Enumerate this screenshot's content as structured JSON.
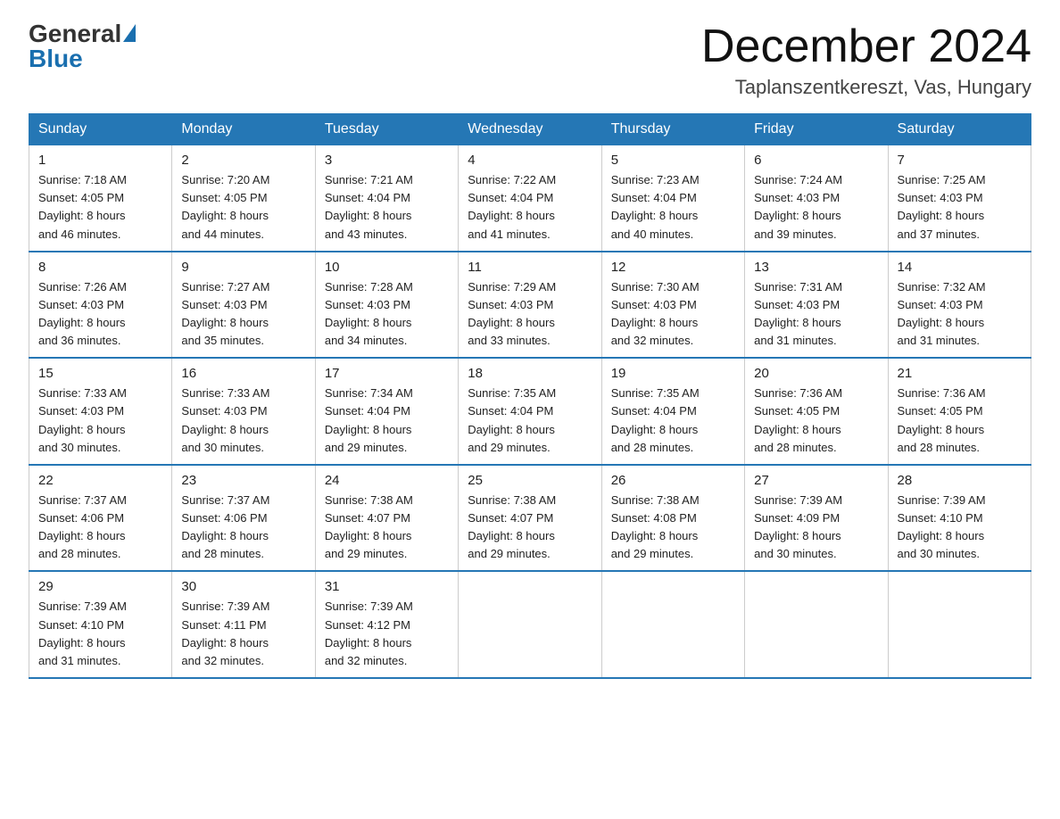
{
  "header": {
    "logo_general": "General",
    "logo_blue": "Blue",
    "month_title": "December 2024",
    "location": "Taplanszentkereszt, Vas, Hungary"
  },
  "days_of_week": [
    "Sunday",
    "Monday",
    "Tuesday",
    "Wednesday",
    "Thursday",
    "Friday",
    "Saturday"
  ],
  "weeks": [
    [
      {
        "day": "1",
        "sunrise": "7:18 AM",
        "sunset": "4:05 PM",
        "daylight": "8 hours and 46 minutes."
      },
      {
        "day": "2",
        "sunrise": "7:20 AM",
        "sunset": "4:05 PM",
        "daylight": "8 hours and 44 minutes."
      },
      {
        "day": "3",
        "sunrise": "7:21 AM",
        "sunset": "4:04 PM",
        "daylight": "8 hours and 43 minutes."
      },
      {
        "day": "4",
        "sunrise": "7:22 AM",
        "sunset": "4:04 PM",
        "daylight": "8 hours and 41 minutes."
      },
      {
        "day": "5",
        "sunrise": "7:23 AM",
        "sunset": "4:04 PM",
        "daylight": "8 hours and 40 minutes."
      },
      {
        "day": "6",
        "sunrise": "7:24 AM",
        "sunset": "4:03 PM",
        "daylight": "8 hours and 39 minutes."
      },
      {
        "day": "7",
        "sunrise": "7:25 AM",
        "sunset": "4:03 PM",
        "daylight": "8 hours and 37 minutes."
      }
    ],
    [
      {
        "day": "8",
        "sunrise": "7:26 AM",
        "sunset": "4:03 PM",
        "daylight": "8 hours and 36 minutes."
      },
      {
        "day": "9",
        "sunrise": "7:27 AM",
        "sunset": "4:03 PM",
        "daylight": "8 hours and 35 minutes."
      },
      {
        "day": "10",
        "sunrise": "7:28 AM",
        "sunset": "4:03 PM",
        "daylight": "8 hours and 34 minutes."
      },
      {
        "day": "11",
        "sunrise": "7:29 AM",
        "sunset": "4:03 PM",
        "daylight": "8 hours and 33 minutes."
      },
      {
        "day": "12",
        "sunrise": "7:30 AM",
        "sunset": "4:03 PM",
        "daylight": "8 hours and 32 minutes."
      },
      {
        "day": "13",
        "sunrise": "7:31 AM",
        "sunset": "4:03 PM",
        "daylight": "8 hours and 31 minutes."
      },
      {
        "day": "14",
        "sunrise": "7:32 AM",
        "sunset": "4:03 PM",
        "daylight": "8 hours and 31 minutes."
      }
    ],
    [
      {
        "day": "15",
        "sunrise": "7:33 AM",
        "sunset": "4:03 PM",
        "daylight": "8 hours and 30 minutes."
      },
      {
        "day": "16",
        "sunrise": "7:33 AM",
        "sunset": "4:03 PM",
        "daylight": "8 hours and 30 minutes."
      },
      {
        "day": "17",
        "sunrise": "7:34 AM",
        "sunset": "4:04 PM",
        "daylight": "8 hours and 29 minutes."
      },
      {
        "day": "18",
        "sunrise": "7:35 AM",
        "sunset": "4:04 PM",
        "daylight": "8 hours and 29 minutes."
      },
      {
        "day": "19",
        "sunrise": "7:35 AM",
        "sunset": "4:04 PM",
        "daylight": "8 hours and 28 minutes."
      },
      {
        "day": "20",
        "sunrise": "7:36 AM",
        "sunset": "4:05 PM",
        "daylight": "8 hours and 28 minutes."
      },
      {
        "day": "21",
        "sunrise": "7:36 AM",
        "sunset": "4:05 PM",
        "daylight": "8 hours and 28 minutes."
      }
    ],
    [
      {
        "day": "22",
        "sunrise": "7:37 AM",
        "sunset": "4:06 PM",
        "daylight": "8 hours and 28 minutes."
      },
      {
        "day": "23",
        "sunrise": "7:37 AM",
        "sunset": "4:06 PM",
        "daylight": "8 hours and 28 minutes."
      },
      {
        "day": "24",
        "sunrise": "7:38 AM",
        "sunset": "4:07 PM",
        "daylight": "8 hours and 29 minutes."
      },
      {
        "day": "25",
        "sunrise": "7:38 AM",
        "sunset": "4:07 PM",
        "daylight": "8 hours and 29 minutes."
      },
      {
        "day": "26",
        "sunrise": "7:38 AM",
        "sunset": "4:08 PM",
        "daylight": "8 hours and 29 minutes."
      },
      {
        "day": "27",
        "sunrise": "7:39 AM",
        "sunset": "4:09 PM",
        "daylight": "8 hours and 30 minutes."
      },
      {
        "day": "28",
        "sunrise": "7:39 AM",
        "sunset": "4:10 PM",
        "daylight": "8 hours and 30 minutes."
      }
    ],
    [
      {
        "day": "29",
        "sunrise": "7:39 AM",
        "sunset": "4:10 PM",
        "daylight": "8 hours and 31 minutes."
      },
      {
        "day": "30",
        "sunrise": "7:39 AM",
        "sunset": "4:11 PM",
        "daylight": "8 hours and 32 minutes."
      },
      {
        "day": "31",
        "sunrise": "7:39 AM",
        "sunset": "4:12 PM",
        "daylight": "8 hours and 32 minutes."
      },
      null,
      null,
      null,
      null
    ]
  ],
  "labels": {
    "sunrise": "Sunrise:",
    "sunset": "Sunset:",
    "daylight": "Daylight:"
  }
}
